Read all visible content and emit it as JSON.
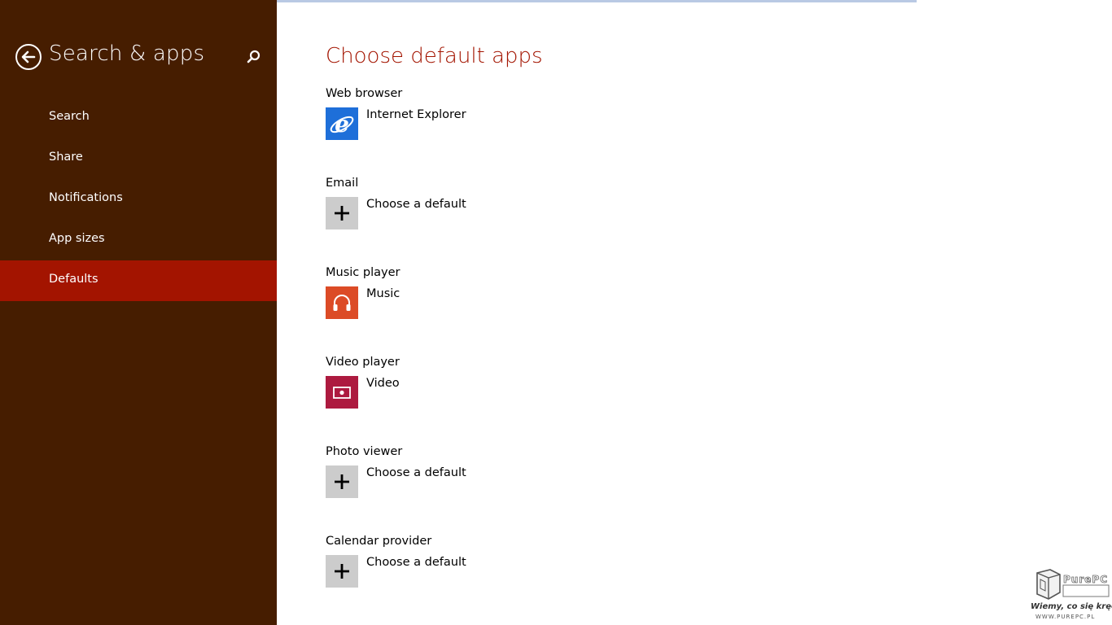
{
  "sidebar": {
    "title": "Search & apps",
    "back_icon": "back-arrow-circle-icon",
    "search_icon": "search-icon",
    "items": [
      {
        "label": "Search",
        "selected": false
      },
      {
        "label": "Share",
        "selected": false
      },
      {
        "label": "Notifications",
        "selected": false
      },
      {
        "label": "App sizes",
        "selected": false
      },
      {
        "label": "Defaults",
        "selected": true
      }
    ]
  },
  "main": {
    "title": "Choose default apps",
    "groups": [
      {
        "label": "Web browser",
        "app": "Internet Explorer",
        "icon": "internet-explorer-icon",
        "tile_color": "#1e6fd9"
      },
      {
        "label": "Email",
        "app": "Choose a default",
        "icon": "plus-icon",
        "tile_color": "#cccccc"
      },
      {
        "label": "Music player",
        "app": "Music",
        "icon": "headphones-icon",
        "tile_color": "#dc4b26"
      },
      {
        "label": "Video player",
        "app": "Video",
        "icon": "video-icon",
        "tile_color": "#ad1a3f"
      },
      {
        "label": "Photo viewer",
        "app": "Choose a default",
        "icon": "plus-icon",
        "tile_color": "#cccccc"
      },
      {
        "label": "Calendar provider",
        "app": "Choose a default",
        "icon": "plus-icon",
        "tile_color": "#cccccc"
      }
    ]
  },
  "watermark": {
    "brand": "PurePC",
    "tagline": "Wiemy, co się kręci !",
    "url": "WWW.PUREPC.PL"
  },
  "colors": {
    "sidebar_bg": "#461d00",
    "selected_bg": "#a31400",
    "accent": "#a31400"
  }
}
